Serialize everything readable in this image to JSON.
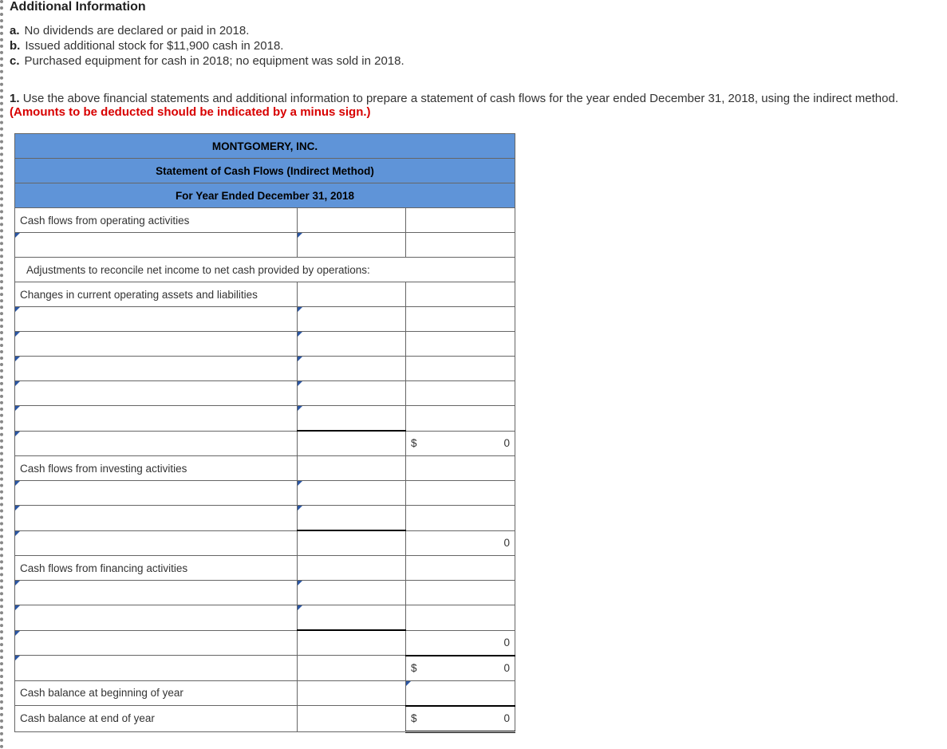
{
  "heading": "Additional Information",
  "info": {
    "a": "No dividends are declared or paid in 2018.",
    "b": "Issued additional stock for $11,900 cash in 2018.",
    "c": "Purchased equipment for cash in 2018; no equipment was sold in 2018."
  },
  "question_prefix": "1.",
  "question_text": "Use the above financial statements and additional information to prepare a statement of cash flows for the year ended December 31, 2018, using the indirect method.",
  "question_hint": "(Amounts to be deducted should be indicated by a minus sign.)",
  "table": {
    "company": "MONTGOMERY, INC.",
    "title": "Statement of Cash Flows (Indirect Method)",
    "period": "For Year Ended December 31, 2018",
    "rows": {
      "op_header": "Cash flows from operating activities",
      "adjust": "Adjustments to reconcile net income to net cash provided by operations:",
      "changes": "Changes in current operating assets and liabilities",
      "inv_header": "Cash flows from investing activities",
      "fin_header": "Cash flows from financing activities",
      "beg": "Cash balance at beginning of year",
      "end": "Cash balance at end of year"
    },
    "totals": {
      "op": "0",
      "inv": "0",
      "fin": "0",
      "net": "0",
      "end": "0"
    },
    "dollar": "$"
  }
}
